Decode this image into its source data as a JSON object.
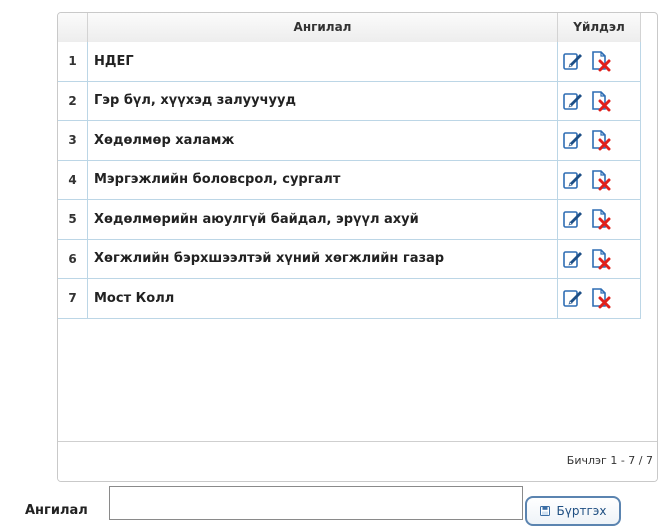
{
  "grid": {
    "columns": {
      "category": "Ангилал",
      "actions": "Үйлдэл"
    },
    "rows": [
      {
        "num": "1",
        "category": "НДЕГ"
      },
      {
        "num": "2",
        "category": "Гэр бүл, хүүхэд залуучууд"
      },
      {
        "num": "3",
        "category": "Хөдөлмөр халамж"
      },
      {
        "num": "4",
        "category": "Мэргэжлийн боловсрол, сургалт"
      },
      {
        "num": "5",
        "category": "Хөдөлмөрийн аюулгүй байдал, эрүүл ахуй"
      },
      {
        "num": "6",
        "category": "Хөгжлийн бэрхшээлтэй хүний хөгжлийн газар"
      },
      {
        "num": "7",
        "category": "Мост Колл"
      }
    ],
    "pager": "Бичлэг 1 - 7 / 7",
    "icons": {
      "edit": "edit-icon",
      "delete": "delete-icon"
    }
  },
  "form": {
    "label": "Ангилал",
    "input_value": "",
    "save_label": "Бүртгэх"
  },
  "colors": {
    "icon_blue": "#2e6db4",
    "delete_red": "#e0201b",
    "row_border": "#bcd6e6",
    "button_border": "#5b84b0"
  }
}
